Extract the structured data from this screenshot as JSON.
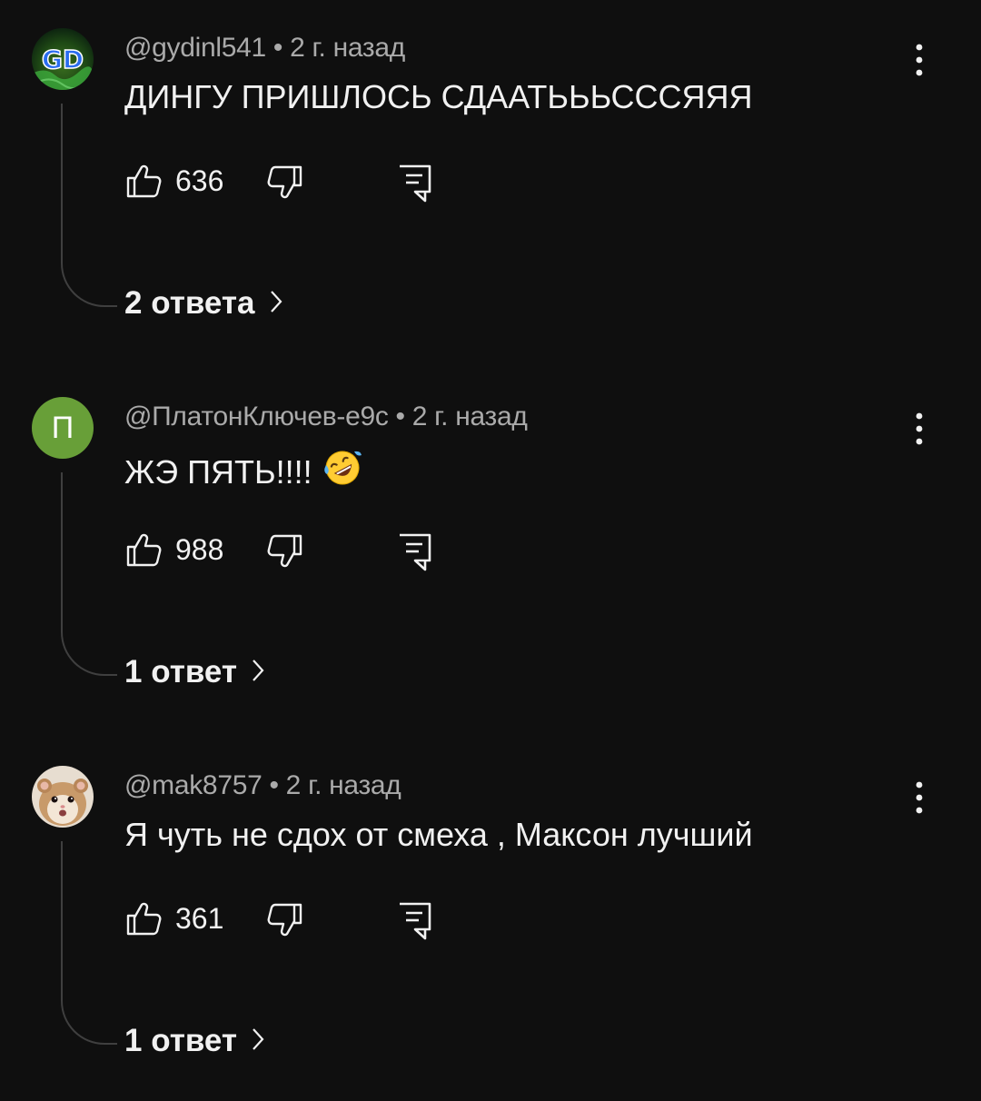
{
  "comments": [
    {
      "author": "@gydinl541",
      "time": "2 г. назад",
      "separator": "•",
      "text": "ДИНГУ ПРИШЛОСЬ СДААТЬЬЬСССЯЯЯ",
      "likes": "636",
      "replies_label": "2 ответа",
      "avatar_text": "GD"
    },
    {
      "author": "@ПлатонКлючев-е9с",
      "time": "2 г. назад",
      "separator": "•",
      "text": "ЖЭ ПЯТЬ!!!!",
      "emoji": "rolling-on-floor-laughing",
      "likes": "988",
      "replies_label": "1 ответ",
      "avatar_letter": "П"
    },
    {
      "author": "@mak8757",
      "time": "2 г. назад",
      "separator": "•",
      "text": "Я чуть не сдох от смеха , Максон лучший",
      "likes": "361",
      "replies_label": "1 ответ",
      "avatar": "hamster-photo"
    }
  ],
  "colors": {
    "background": "#0f0f0f",
    "text_primary": "#f1f1f1",
    "text_secondary": "#aaaaaa",
    "thread_line": "#3f3f3f",
    "avatar_green": "#689f38"
  }
}
